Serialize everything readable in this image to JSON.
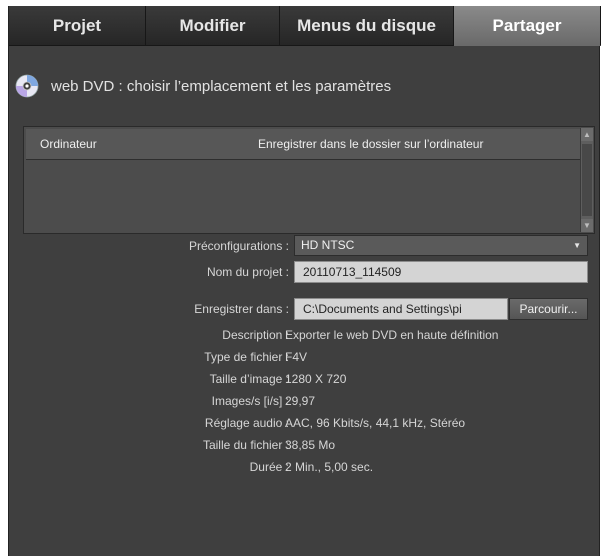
{
  "tabs": [
    {
      "label": "Projet"
    },
    {
      "label": "Modifier"
    },
    {
      "label": "Menus du disque"
    },
    {
      "label": "Partager"
    }
  ],
  "heading": {
    "text": "web DVD : choisir l’emplacement et les paramètres"
  },
  "destinations": {
    "rows": [
      {
        "name": "Ordinateur",
        "description": "Enregistrer dans le dossier sur l’ordinateur"
      }
    ]
  },
  "form": {
    "preset_label": "Préconfigurations :",
    "preset_value": "HD NTSC",
    "project_label": "Nom du projet :",
    "project_value": "20110713_114509",
    "save_label": "Enregistrer dans :",
    "save_value": "C:\\Documents and Settings\\pi",
    "browse_label": "Parcourir..."
  },
  "details": {
    "description_label": "Description :",
    "description_value": "Exporter le web DVD en haute définition",
    "filetype_label": "Type de fichier :",
    "filetype_value": "F4V",
    "imagesize_label": "Taille d’image :",
    "imagesize_value": "1280 X 720",
    "fps_label": "Images/s [i/s] :",
    "fps_value": "29,97",
    "audio_label": "Réglage audio :",
    "audio_value": "AAC, 96 Kbits/s, 44,1 kHz, Stéréo",
    "filesize_label": "Taille du fichier :",
    "filesize_value": "38,85 Mo",
    "duration_label": "Durée :",
    "duration_value": "2 Min., 5,00 sec."
  }
}
